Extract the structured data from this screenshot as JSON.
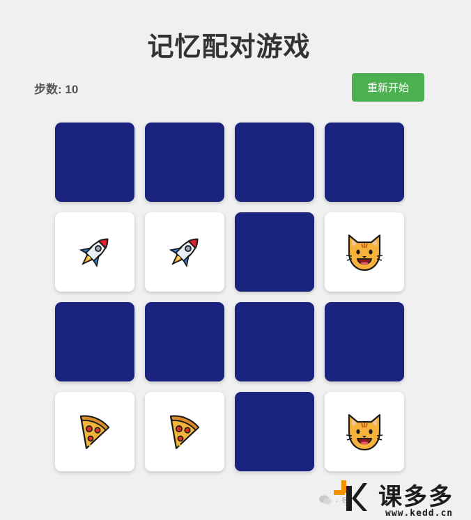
{
  "header": {
    "title": "记忆配对游戏"
  },
  "status": {
    "steps_label": "步数: 10"
  },
  "controls": {
    "restart_label": "重新开始",
    "restart_color": "#4caf50"
  },
  "board": {
    "columns": 4,
    "rows": 4,
    "card_back_color": "#1a237e",
    "card_face_color": "#ffffff",
    "cards": [
      {
        "state": "hidden",
        "icon": ""
      },
      {
        "state": "hidden",
        "icon": ""
      },
      {
        "state": "hidden",
        "icon": ""
      },
      {
        "state": "hidden",
        "icon": ""
      },
      {
        "state": "revealed",
        "icon": "rocket-icon"
      },
      {
        "state": "revealed",
        "icon": "rocket-icon"
      },
      {
        "state": "hidden",
        "icon": ""
      },
      {
        "state": "revealed",
        "icon": "cat-face-icon"
      },
      {
        "state": "hidden",
        "icon": ""
      },
      {
        "state": "hidden",
        "icon": ""
      },
      {
        "state": "hidden",
        "icon": ""
      },
      {
        "state": "hidden",
        "icon": ""
      },
      {
        "state": "revealed",
        "icon": "pizza-slice-icon"
      },
      {
        "state": "revealed",
        "icon": "pizza-slice-icon"
      },
      {
        "state": "hidden",
        "icon": ""
      },
      {
        "state": "revealed",
        "icon": "cat-face-icon"
      }
    ]
  },
  "watermark": {
    "brand": "课多多",
    "url": "www.kedd.cn",
    "small_text": "· 号"
  }
}
